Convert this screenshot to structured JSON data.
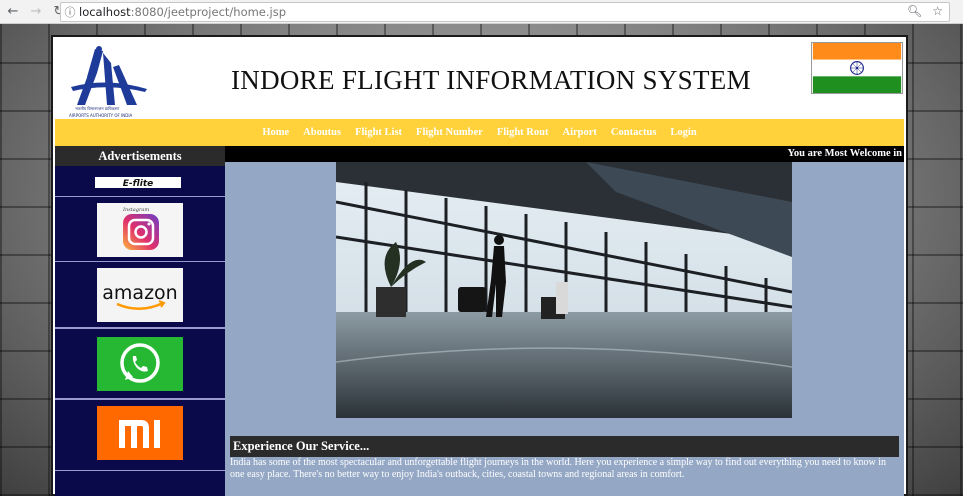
{
  "browser": {
    "url_host": "localhost",
    "url_path": ":8080/jeetproject/home.jsp",
    "back_icon": "arrow-left-icon",
    "forward_icon": "arrow-right-icon",
    "reload_icon": "reload-icon",
    "info_icon": "info-icon",
    "zoom_icon": "magnifier-icon",
    "bookmark_icon": "star-icon"
  },
  "header": {
    "title": "INDORE FLIGHT INFORMATION SYSTEM",
    "logo_caption": "AIRPORTS AUTHORITY OF INDIA"
  },
  "nav": {
    "items": [
      {
        "label": "Home"
      },
      {
        "label": "Aboutus"
      },
      {
        "label": "Flight List"
      },
      {
        "label": "Flight Number"
      },
      {
        "label": "Flight Rout"
      },
      {
        "label": "Airport"
      },
      {
        "label": "Contactus"
      },
      {
        "label": "Login"
      }
    ]
  },
  "sidebar": {
    "title": "Advertisements",
    "ads": [
      {
        "name": "e-flite",
        "label": "E-flite"
      },
      {
        "name": "instagram",
        "label": "Instagram"
      },
      {
        "name": "amazon",
        "label": "amazon"
      },
      {
        "name": "whatsapp",
        "label": ""
      },
      {
        "name": "mi",
        "label": "mi"
      }
    ]
  },
  "main": {
    "marquee": "You are Most Welcome in",
    "section_title": "Experience Our Service...",
    "section_text": "India has some of the most spectacular and unforgettable flight journeys in the world. Here you experience a simple way to find out everything you need to know in one easy place. There's no better way to enjoy India's outback, cities, coastal towns and regional areas in comfort."
  },
  "colors": {
    "navbar": "#ffd23c",
    "sidebar": "#0a0a4a",
    "content": "#94a8c6",
    "title_bar": "#2b2b2b"
  }
}
